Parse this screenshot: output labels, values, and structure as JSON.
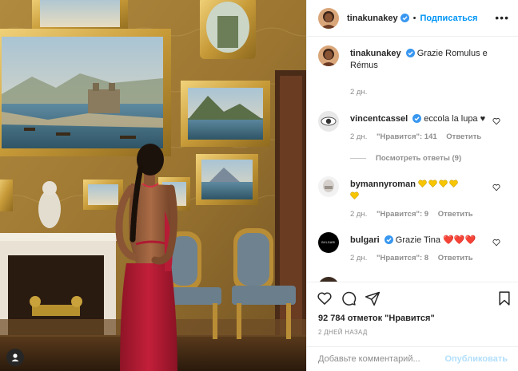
{
  "header": {
    "username": "tinakunakey",
    "separator": "•",
    "follow_label": "Подписаться",
    "more_icon": "more-horizontal-icon"
  },
  "caption": {
    "username": "tinakunakey",
    "text": "Grazie Romulus e Rémus",
    "time": "2 дн."
  },
  "comments": [
    {
      "username": "vincentcassel",
      "text": "eccola la lupa ♥",
      "time": "2 дн.",
      "likes": "\"Нравится\": 141",
      "reply": "Ответить",
      "view_replies": "Посмотреть ответы (9)"
    },
    {
      "username": "bymannyroman",
      "text": "",
      "emoji": "💛💛💛💛💛",
      "time": "2 дн.",
      "likes": "\"Нравится\": 9",
      "reply": "Ответить"
    },
    {
      "username": "bulgari",
      "text": "Grazie Tina ❤️❤️❤️",
      "avatar_text": "BVLGARI",
      "time": "2 дн.",
      "likes": "\"Нравится\": 8",
      "reply": "Ответить"
    }
  ],
  "actions": {
    "like_icon": "heart-icon",
    "comment_icon": "comment-icon",
    "share_icon": "send-icon",
    "save_icon": "bookmark-icon",
    "likes_text": "92 784 отметок \"Нравится\"",
    "time_ago": "2 ДНЕЙ НАЗАД"
  },
  "add_comment": {
    "placeholder": "Добавьте комментарий...",
    "post_label": "Опубликовать"
  },
  "colors": {
    "accent": "#0095f6",
    "verified": "#3897f0",
    "muted": "#8e8e8e",
    "post_disabled": "#b2dffc",
    "dress": "#c31f3a"
  }
}
